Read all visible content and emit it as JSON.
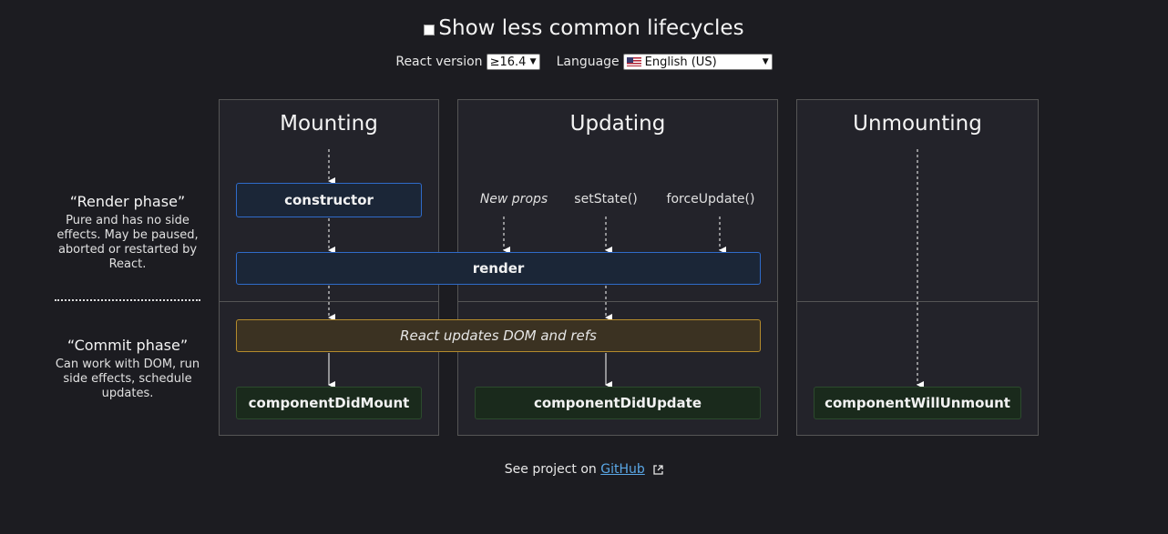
{
  "header": {
    "show_less_common_label": "Show less common lifecycles",
    "react_version_label": "React version",
    "react_version_value": "≥16.4",
    "language_label": "Language",
    "language_value": "English (US)"
  },
  "columns": {
    "mounting": "Mounting",
    "updating": "Updating",
    "unmounting": "Unmounting"
  },
  "nodes": {
    "constructor": "constructor",
    "render": "render",
    "react_updates": "React updates DOM and refs",
    "component_did_mount": "componentDidMount",
    "component_did_update": "componentDidUpdate",
    "component_will_unmount": "componentWillUnmount"
  },
  "triggers": {
    "new_props": "New props",
    "set_state": "setState()",
    "force_update": "forceUpdate()"
  },
  "phases": {
    "render_title": "“Render phase”",
    "render_desc": "Pure and has no side effects. May be paused, aborted or restarted by React.",
    "commit_title": "“Commit phase”",
    "commit_desc": "Can work with DOM, run side effects, schedule updates."
  },
  "footer": {
    "prefix": "See project on",
    "link": "GitHub"
  },
  "colors": {
    "background": "#1c1c21",
    "render_phase_box": "#2f6bc9",
    "dom_update_box": "#b48b2c",
    "commit_box": "#2c4a2d",
    "link": "#5aa7e6"
  }
}
